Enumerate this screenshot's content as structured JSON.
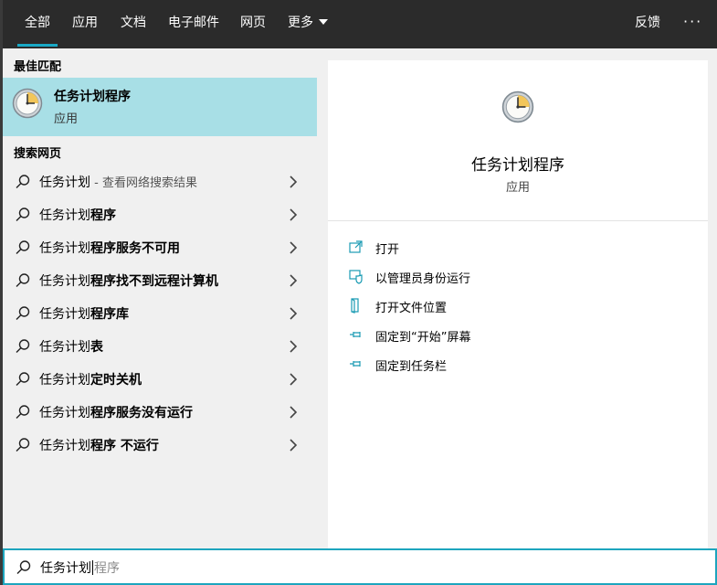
{
  "tabs": [
    {
      "label": "全部",
      "active": true
    },
    {
      "label": "应用"
    },
    {
      "label": "文档"
    },
    {
      "label": "电子邮件"
    },
    {
      "label": "网页"
    },
    {
      "label": "更多"
    }
  ],
  "header": {
    "feedback_label": "反馈",
    "more_options": "···"
  },
  "left": {
    "best_match_heading": "最佳匹配",
    "best_match": {
      "title": "任务计划程序",
      "subtitle": "应用",
      "icon": "clock-icon"
    },
    "web_heading": "搜索网页",
    "web_items": [
      {
        "query": "任务计划",
        "bold": "",
        "hint": " - 查看网络搜索结果"
      },
      {
        "query": "任务计划",
        "bold": "程序",
        "hint": ""
      },
      {
        "query": "任务计划",
        "bold": "程序服务不可用",
        "hint": ""
      },
      {
        "query": "任务计划",
        "bold": "程序找不到远程计算机",
        "hint": ""
      },
      {
        "query": "任务计划",
        "bold": "程序库",
        "hint": ""
      },
      {
        "query": "任务计划",
        "bold": "表",
        "hint": ""
      },
      {
        "query": "任务计划",
        "bold": "定时关机",
        "hint": ""
      },
      {
        "query": "任务计划",
        "bold": "程序服务没有运行",
        "hint": ""
      },
      {
        "query": "任务计划",
        "bold": "程序 不运行",
        "hint": ""
      }
    ]
  },
  "right": {
    "title": "任务计划程序",
    "subtitle": "应用",
    "actions": [
      {
        "label": "打开",
        "icon": "open-icon"
      },
      {
        "label": "以管理员身份运行",
        "icon": "shield-icon"
      },
      {
        "label": "打开文件位置",
        "icon": "file-location-icon"
      },
      {
        "label": "固定到“开始”屏幕",
        "icon": "pin-icon"
      },
      {
        "label": "固定到任务栏",
        "icon": "pin-icon"
      }
    ]
  },
  "search": {
    "typed": "任务计划",
    "suggestion": "程序"
  },
  "colors": {
    "accent": "#19a9c6",
    "highlight": "#a8dfe6",
    "topbar": "#2b2b2b"
  }
}
